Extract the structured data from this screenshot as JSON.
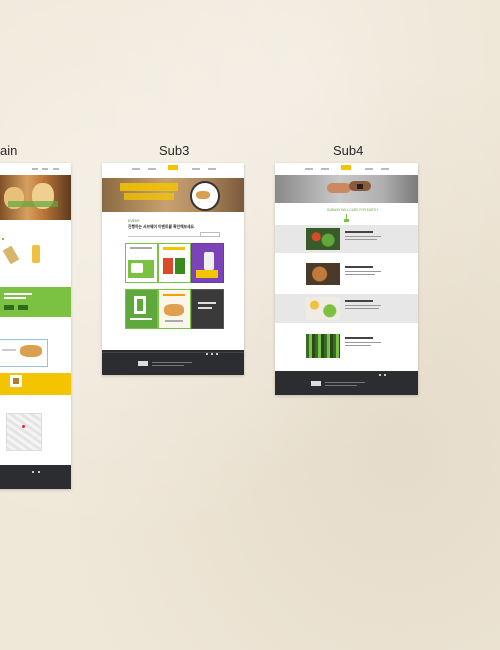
{
  "labels": {
    "main": "ain",
    "sub3": "Sub3",
    "sub4": "Sub4"
  },
  "sub3": {
    "section_tag": "EVENT",
    "section_title": "진행하는 서브웨이 이벤트를 확인해보세요."
  },
  "sub4": {
    "headline": "SUBWAY WILL CARE FOR EARTH"
  },
  "colors": {
    "background": "#efe7d8",
    "accent_green": "#7cc242",
    "accent_yellow": "#f5c400",
    "footer": "#2b2d31"
  }
}
